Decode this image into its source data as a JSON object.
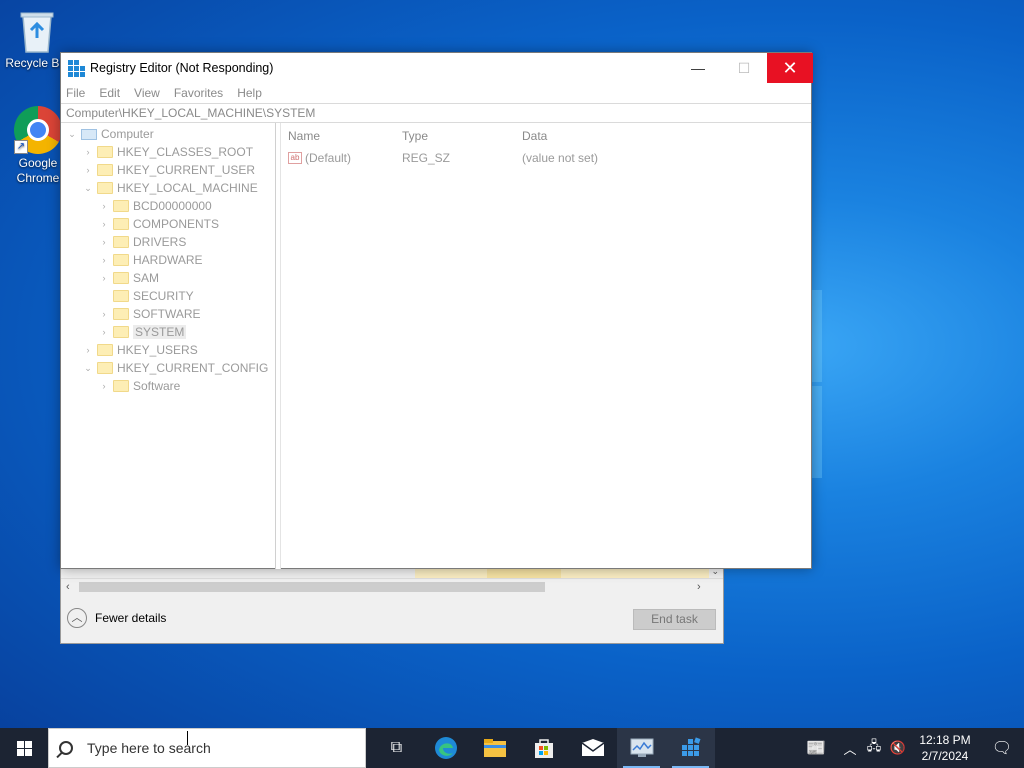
{
  "desktop": {
    "icons": [
      {
        "label": "Recycle Bin",
        "icon": "recycle-bin-icon"
      },
      {
        "label": "Google Chrome",
        "icon": "chrome-icon"
      }
    ]
  },
  "registry_editor": {
    "title": "Registry Editor (Not Responding)",
    "menu": [
      "File",
      "Edit",
      "View",
      "Favorites",
      "Help"
    ],
    "address": "Computer\\HKEY_LOCAL_MACHINE\\SYSTEM",
    "tree": {
      "root": "Computer",
      "hives": [
        "HKEY_CLASSES_ROOT",
        "HKEY_CURRENT_USER",
        "HKEY_LOCAL_MACHINE"
      ],
      "hklm_children": [
        "BCD00000000",
        "COMPONENTS",
        "DRIVERS",
        "HARDWARE",
        "SAM",
        "SECURITY",
        "SOFTWARE",
        "SYSTEM"
      ],
      "hives_after": [
        "HKEY_USERS",
        "HKEY_CURRENT_CONFIG"
      ],
      "current_config_children": [
        "Software"
      ],
      "selected": "SYSTEM"
    },
    "columns": {
      "name": "Name",
      "type": "Type",
      "data": "Data"
    },
    "values": [
      {
        "name": "(Default)",
        "type": "REG_SZ",
        "data": "(value not set)"
      }
    ],
    "window_buttons": {
      "minimize": "—",
      "maximize": "☐",
      "close": "✕"
    }
  },
  "task_manager": {
    "fewer_details": "Fewer details",
    "end_task": "End task"
  },
  "taskbar": {
    "search_placeholder": "Type here to search",
    "apps": [
      "task-view-icon",
      "edge-icon",
      "file-explorer-icon",
      "store-icon",
      "mail-icon",
      "task-manager-icon",
      "regedit-icon"
    ],
    "time": "12:18 PM",
    "date": "2/7/2024"
  }
}
